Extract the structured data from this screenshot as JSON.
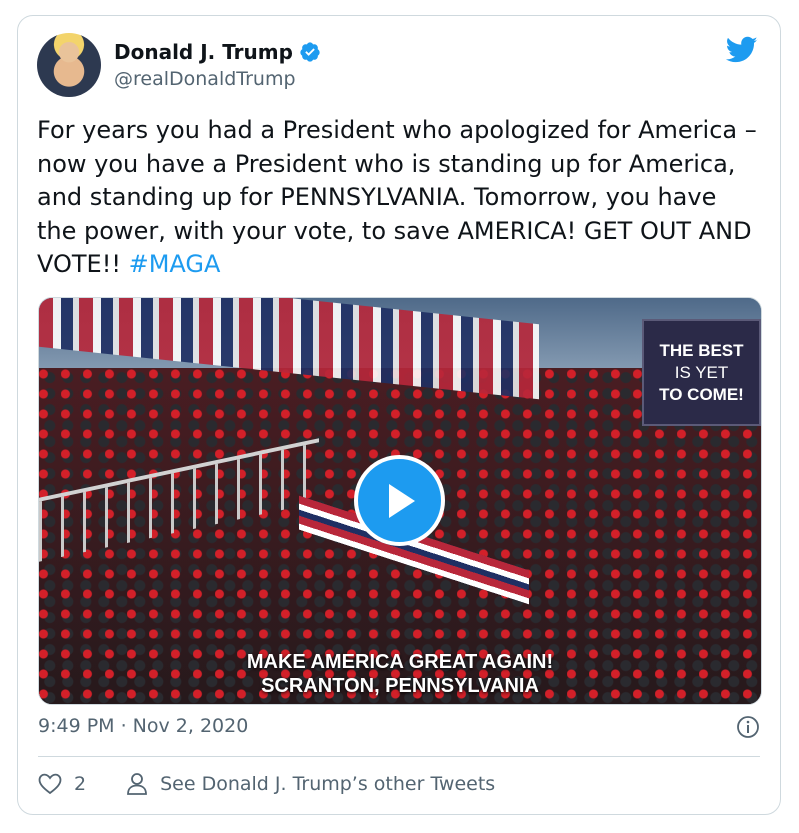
{
  "author": {
    "name": "Donald J. Trump",
    "handle": "@realDonaldTrump",
    "verified": true
  },
  "tweet": {
    "text": "For years you had a President who apologized for America – now you have a President who is standing up for America, and standing up for PENNSYLVANIA. Tomorrow, you have the power, with your vote, to save AMERICA! GET OUT AND VOTE!!",
    "hashtag": "#MAGA"
  },
  "media": {
    "type": "video",
    "sign_line1": "THE BEST",
    "sign_line2": "IS YET",
    "sign_line3": "TO COME!",
    "caption_line1": "MAKE AMERICA GREAT AGAIN!",
    "caption_line2": "SCRANTON, PENNSYLVANIA"
  },
  "meta": {
    "timestamp": "9:49 PM · Nov 2, 2020"
  },
  "actions": {
    "like_count": "2",
    "other_tweets_label": "See Donald J. Trump’s other Tweets"
  },
  "colors": {
    "accent": "#1d9bf0",
    "text": "#0f1419",
    "secondary": "#536471",
    "border": "#cfd9de"
  },
  "icons": [
    "verified-badge-icon",
    "twitter-bird-icon",
    "play-icon",
    "info-icon",
    "heart-icon",
    "person-icon"
  ]
}
